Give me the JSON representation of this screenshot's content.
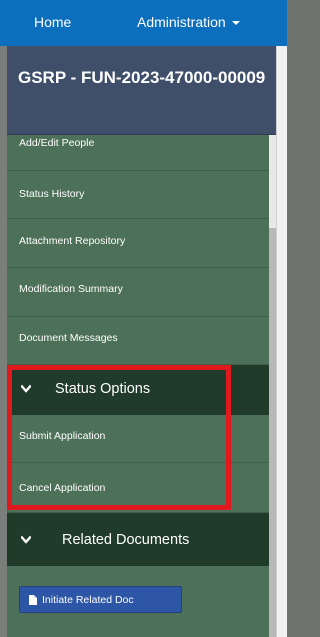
{
  "topnav": {
    "home_label": "Home",
    "admin_label": "Administration"
  },
  "panel": {
    "title": "GSRP - FUN-2023-47000-00009"
  },
  "menu": {
    "items": [
      {
        "label": "Add/Edit People"
      },
      {
        "label": "Status History"
      },
      {
        "label": "Attachment Repository"
      },
      {
        "label": "Modification Summary"
      },
      {
        "label": "Document Messages"
      }
    ],
    "status_section": {
      "label": "Status Options",
      "items": [
        {
          "label": "Submit Application"
        },
        {
          "label": "Cancel Application"
        }
      ]
    },
    "related_section": {
      "label": "Related Documents",
      "button_label": "Initiate Related Doc"
    }
  },
  "colors": {
    "nav_blue": "#0c6fbe",
    "title_bg": "#3f4e69",
    "menu_green": "#4d7058",
    "section_dark": "#213b2a",
    "highlight_red": "#e1191e",
    "button_blue": "#2e56a7"
  }
}
